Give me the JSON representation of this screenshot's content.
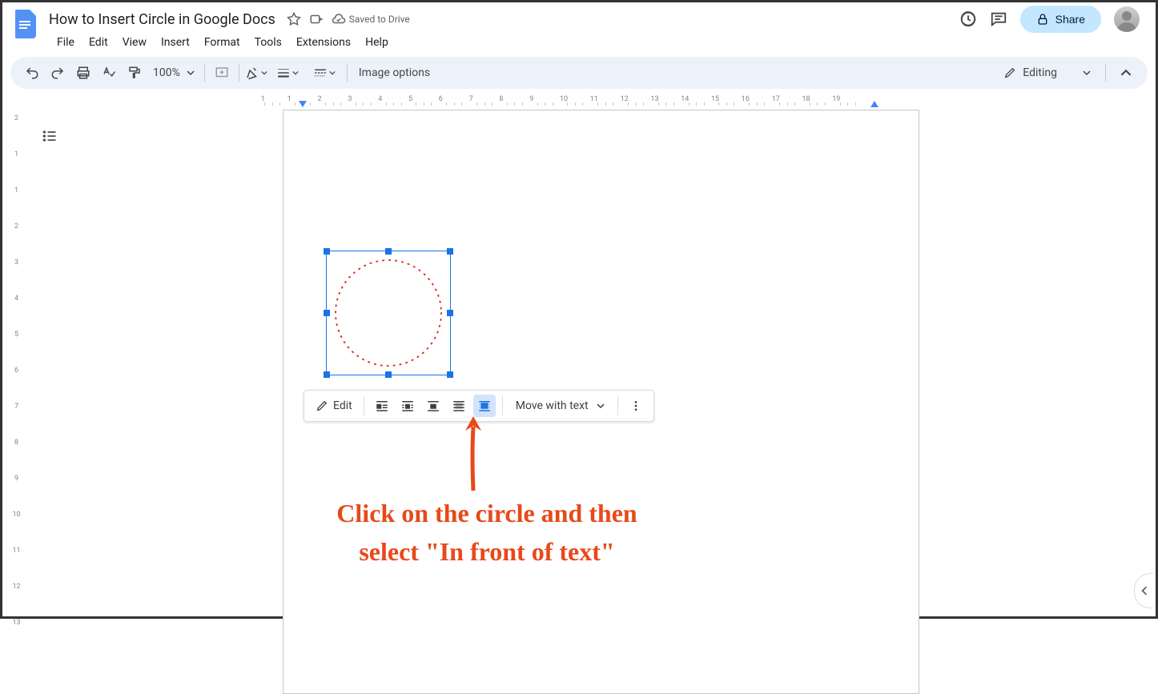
{
  "header": {
    "title": "How to Insert Circle in Google Docs",
    "save_status": "Saved to Drive"
  },
  "menus": [
    "File",
    "Edit",
    "View",
    "Insert",
    "Format",
    "Tools",
    "Extensions",
    "Help"
  ],
  "toolbar": {
    "zoom": "100%",
    "image_options": "Image options",
    "editing": "Editing"
  },
  "share": {
    "label": "Share"
  },
  "float_toolbar": {
    "edit": "Edit",
    "move_with_text": "Move with text"
  },
  "hruler_ticks": [
    1,
    1,
    2,
    3,
    4,
    5,
    6,
    7,
    8,
    9,
    10,
    11,
    12,
    13,
    14,
    15,
    16,
    17,
    18,
    19
  ],
  "vruler_ticks": [
    2,
    1,
    1,
    2,
    3,
    4,
    5,
    6,
    7,
    8,
    9,
    10,
    11,
    12,
    13
  ],
  "annotation": {
    "line1": "Click on the circle and then",
    "line2": "select \"In front of text\""
  }
}
